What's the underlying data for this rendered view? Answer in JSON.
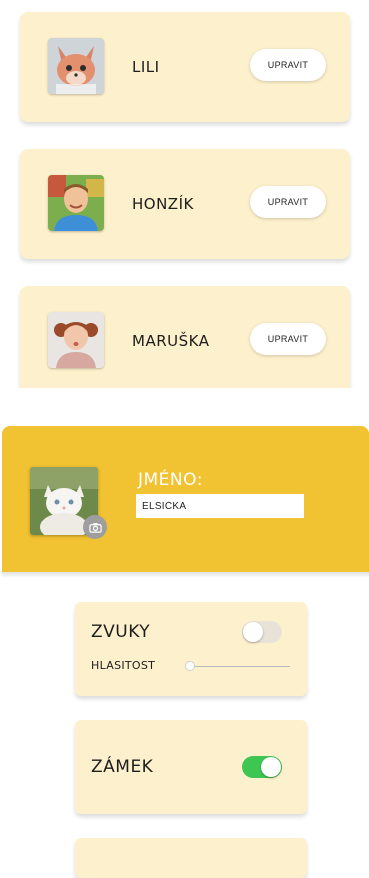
{
  "profiles": [
    {
      "name": "LILI",
      "avatar_icon": "cartoon-fox-avatar-icon",
      "edit_label": "UPRAVIT"
    },
    {
      "name": "HONZÍK",
      "avatar_icon": "boy-photo-avatar-icon",
      "edit_label": "UPRAVIT"
    },
    {
      "name": "MARUŠKA",
      "avatar_icon": "girl-photo-avatar-icon",
      "edit_label": "UPRAVIT"
    }
  ],
  "editor": {
    "avatar_icon": "white-cat-photo-avatar-icon",
    "camera_icon": "camera-icon",
    "name_label": "JMÉNO:",
    "name_value": "ELSIČKA"
  },
  "settings": {
    "sounds": {
      "label": "ZVUKY",
      "enabled": false,
      "volume_label": "HLASITOST",
      "volume": 0.0
    },
    "lock": {
      "label": "ZÁMEK",
      "enabled": true
    }
  },
  "colors": {
    "card_bg": "#fdf0cc",
    "accent_yellow": "#f1c232",
    "toggle_on": "#3ec652",
    "toggle_off": "#e8e3d6"
  }
}
